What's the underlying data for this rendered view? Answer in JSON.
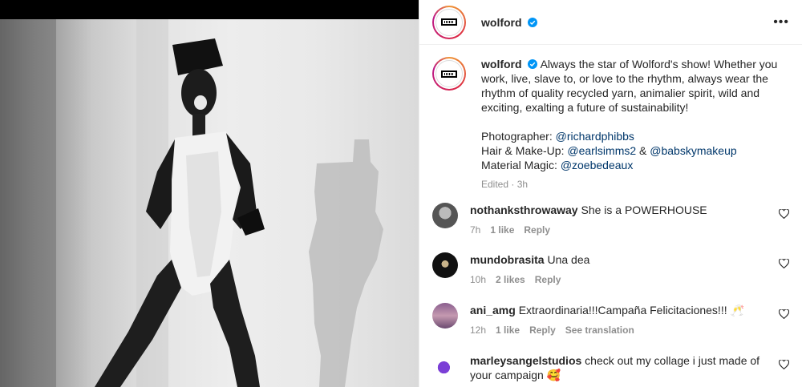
{
  "post": {
    "author": "wolford",
    "caption_text": "Always the star of Wolford's show! Whether you work, live, slave to, or love to the rhythm, always wear the rhythm of quality recycled yarn, animalier spirit, wild and exciting, exalting a future of sustainability!",
    "credit_photographer_label": "Photographer:",
    "credit_photographer": "@richardphibbs",
    "credit_hair_label": "Hair & Make-Up:",
    "credit_hair_1": "@earlsimms2",
    "credit_hair_and": "&",
    "credit_hair_2": "@babskymakeup",
    "credit_material_label": "Material Magic:",
    "credit_material": "@zoebedeaux",
    "edited_meta": "Edited · 3h",
    "more_label": "•••"
  },
  "comments": [
    {
      "user": "nothanksthrowaway",
      "text": "She is a POWERHOUSE",
      "time": "7h",
      "likes": "1 like",
      "reply": "Reply",
      "translate": ""
    },
    {
      "user": "mundobrasita",
      "text": "Una dea",
      "time": "10h",
      "likes": "2 likes",
      "reply": "Reply",
      "translate": ""
    },
    {
      "user": "ani_amg",
      "text": "Extraordinaria!!!Campaña Felicitaciones!!! 🥂",
      "time": "12h",
      "likes": "1 like",
      "reply": "Reply",
      "translate": "See translation"
    },
    {
      "user": "marleysangelstudios",
      "text": "check out my collage i just made of your campaign 🥰",
      "time": "",
      "likes": "",
      "reply": "",
      "translate": ""
    }
  ],
  "colors": {
    "link": "#00376b",
    "muted": "#8e8e8e",
    "verified": "#0095f6"
  },
  "icons": [
    "verified-badge-icon",
    "more-options-icon",
    "heart-icon"
  ]
}
